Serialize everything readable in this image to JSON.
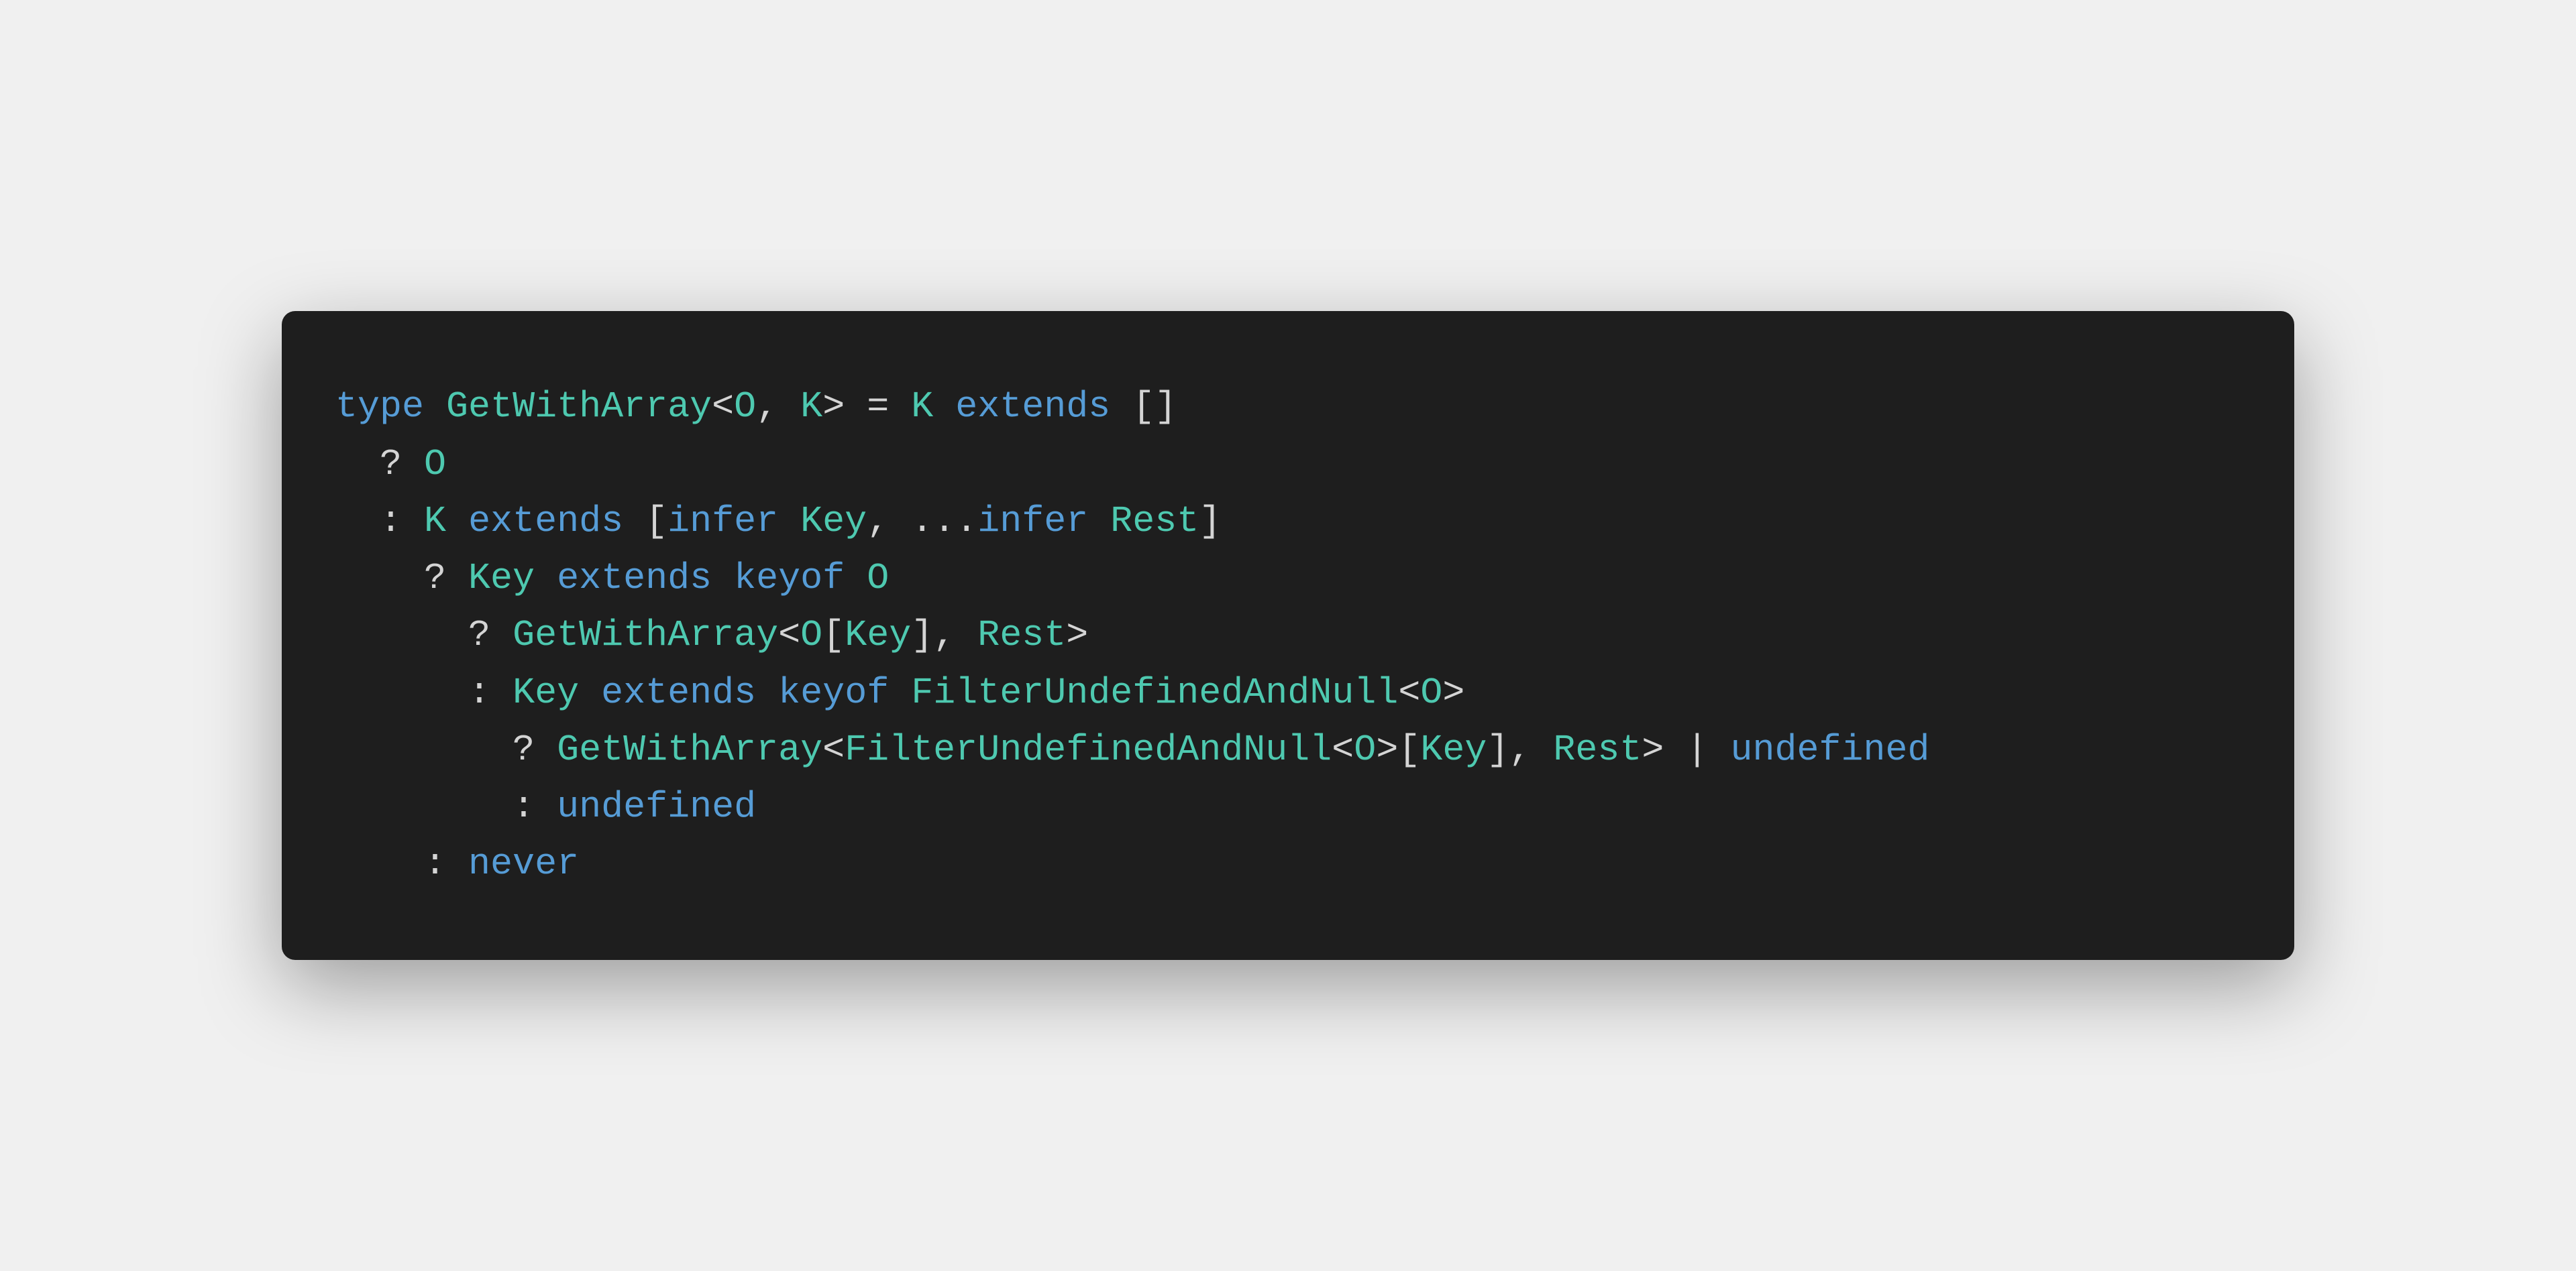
{
  "code": {
    "lines": [
      {
        "indent": 0,
        "tokens": [
          {
            "cls": "kw-type",
            "text": "type"
          },
          {
            "cls": "punct",
            "text": " "
          },
          {
            "cls": "type-name",
            "text": "GetWithArray"
          },
          {
            "cls": "punct",
            "text": "<"
          },
          {
            "cls": "type-param",
            "text": "O"
          },
          {
            "cls": "punct",
            "text": ", "
          },
          {
            "cls": "type-param",
            "text": "K"
          },
          {
            "cls": "punct",
            "text": "> = "
          },
          {
            "cls": "type-param",
            "text": "K"
          },
          {
            "cls": "punct",
            "text": " "
          },
          {
            "cls": "kw-extends",
            "text": "extends"
          },
          {
            "cls": "punct",
            "text": " []"
          }
        ]
      },
      {
        "indent": 1,
        "tokens": [
          {
            "cls": "punct",
            "text": "? "
          },
          {
            "cls": "type-param",
            "text": "O"
          }
        ]
      },
      {
        "indent": 1,
        "tokens": [
          {
            "cls": "punct",
            "text": ": "
          },
          {
            "cls": "type-param",
            "text": "K"
          },
          {
            "cls": "punct",
            "text": " "
          },
          {
            "cls": "kw-extends",
            "text": "extends"
          },
          {
            "cls": "punct",
            "text": " ["
          },
          {
            "cls": "kw-infer",
            "text": "infer"
          },
          {
            "cls": "punct",
            "text": " "
          },
          {
            "cls": "type-param",
            "text": "Key"
          },
          {
            "cls": "punct",
            "text": ", ..."
          },
          {
            "cls": "kw-infer",
            "text": "infer"
          },
          {
            "cls": "punct",
            "text": " "
          },
          {
            "cls": "type-param",
            "text": "Rest"
          },
          {
            "cls": "punct",
            "text": "]"
          }
        ]
      },
      {
        "indent": 2,
        "tokens": [
          {
            "cls": "punct",
            "text": "? "
          },
          {
            "cls": "type-param",
            "text": "Key"
          },
          {
            "cls": "punct",
            "text": " "
          },
          {
            "cls": "kw-extends",
            "text": "extends"
          },
          {
            "cls": "punct",
            "text": " "
          },
          {
            "cls": "kw-keyof",
            "text": "keyof"
          },
          {
            "cls": "punct",
            "text": " "
          },
          {
            "cls": "type-param",
            "text": "O"
          }
        ]
      },
      {
        "indent": 3,
        "tokens": [
          {
            "cls": "punct",
            "text": "? "
          },
          {
            "cls": "type-name",
            "text": "GetWithArray"
          },
          {
            "cls": "punct",
            "text": "<"
          },
          {
            "cls": "type-param",
            "text": "O"
          },
          {
            "cls": "punct",
            "text": "["
          },
          {
            "cls": "type-param",
            "text": "Key"
          },
          {
            "cls": "punct",
            "text": "], "
          },
          {
            "cls": "type-param",
            "text": "Rest"
          },
          {
            "cls": "punct",
            "text": ">"
          }
        ]
      },
      {
        "indent": 3,
        "tokens": [
          {
            "cls": "punct",
            "text": ": "
          },
          {
            "cls": "type-param",
            "text": "Key"
          },
          {
            "cls": "punct",
            "text": " "
          },
          {
            "cls": "kw-extends",
            "text": "extends"
          },
          {
            "cls": "punct",
            "text": " "
          },
          {
            "cls": "kw-keyof",
            "text": "keyof"
          },
          {
            "cls": "punct",
            "text": " "
          },
          {
            "cls": "type-name",
            "text": "FilterUndefinedAndNull"
          },
          {
            "cls": "punct",
            "text": "<"
          },
          {
            "cls": "type-param",
            "text": "O"
          },
          {
            "cls": "punct",
            "text": ">"
          }
        ]
      },
      {
        "indent": 4,
        "tokens": [
          {
            "cls": "punct",
            "text": "? "
          },
          {
            "cls": "type-name",
            "text": "GetWithArray"
          },
          {
            "cls": "punct",
            "text": "<"
          },
          {
            "cls": "type-name",
            "text": "FilterUndefinedAndNull"
          },
          {
            "cls": "punct",
            "text": "<"
          },
          {
            "cls": "type-param",
            "text": "O"
          },
          {
            "cls": "punct",
            "text": ">["
          },
          {
            "cls": "type-param",
            "text": "Key"
          },
          {
            "cls": "punct",
            "text": "], "
          },
          {
            "cls": "type-param",
            "text": "Rest"
          },
          {
            "cls": "punct",
            "text": "> | "
          },
          {
            "cls": "kw-undefined",
            "text": "undefined"
          }
        ]
      },
      {
        "indent": 4,
        "tokens": [
          {
            "cls": "punct",
            "text": ": "
          },
          {
            "cls": "kw-undefined",
            "text": "undefined"
          }
        ]
      },
      {
        "indent": 2,
        "tokens": [
          {
            "cls": "punct",
            "text": ": "
          },
          {
            "cls": "kw-never",
            "text": "never"
          }
        ]
      }
    ]
  },
  "colors": {
    "background_page": "#f0f0f0",
    "background_code": "#1e1e1e",
    "keyword": "#569cd6",
    "type": "#4ec9b0",
    "default": "#d4d4d4"
  }
}
